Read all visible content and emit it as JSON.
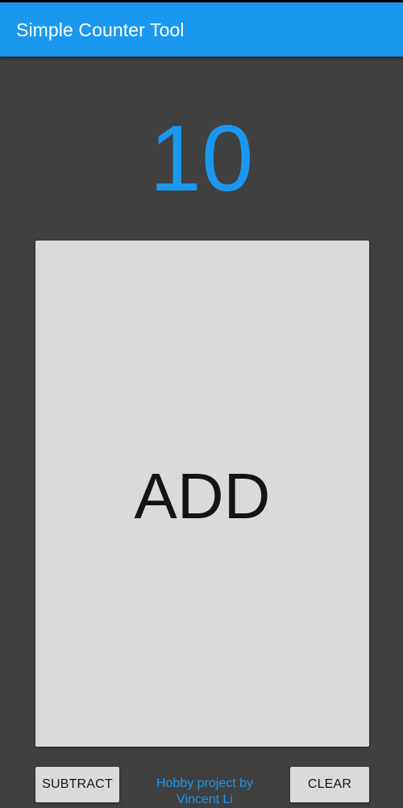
{
  "app_bar": {
    "title": "Simple Counter Tool"
  },
  "counter": {
    "value": "10"
  },
  "buttons": {
    "add_label": "ADD",
    "subtract_label": "SUBTRACT",
    "clear_label": "CLEAR"
  },
  "footer": {
    "credit_line1": "Hobby project by",
    "credit_line2": "Vincent Li"
  },
  "colors": {
    "accent": "#1a98ef",
    "background": "#404040",
    "button_surface": "#d9dbda",
    "button_text": "#141414"
  }
}
